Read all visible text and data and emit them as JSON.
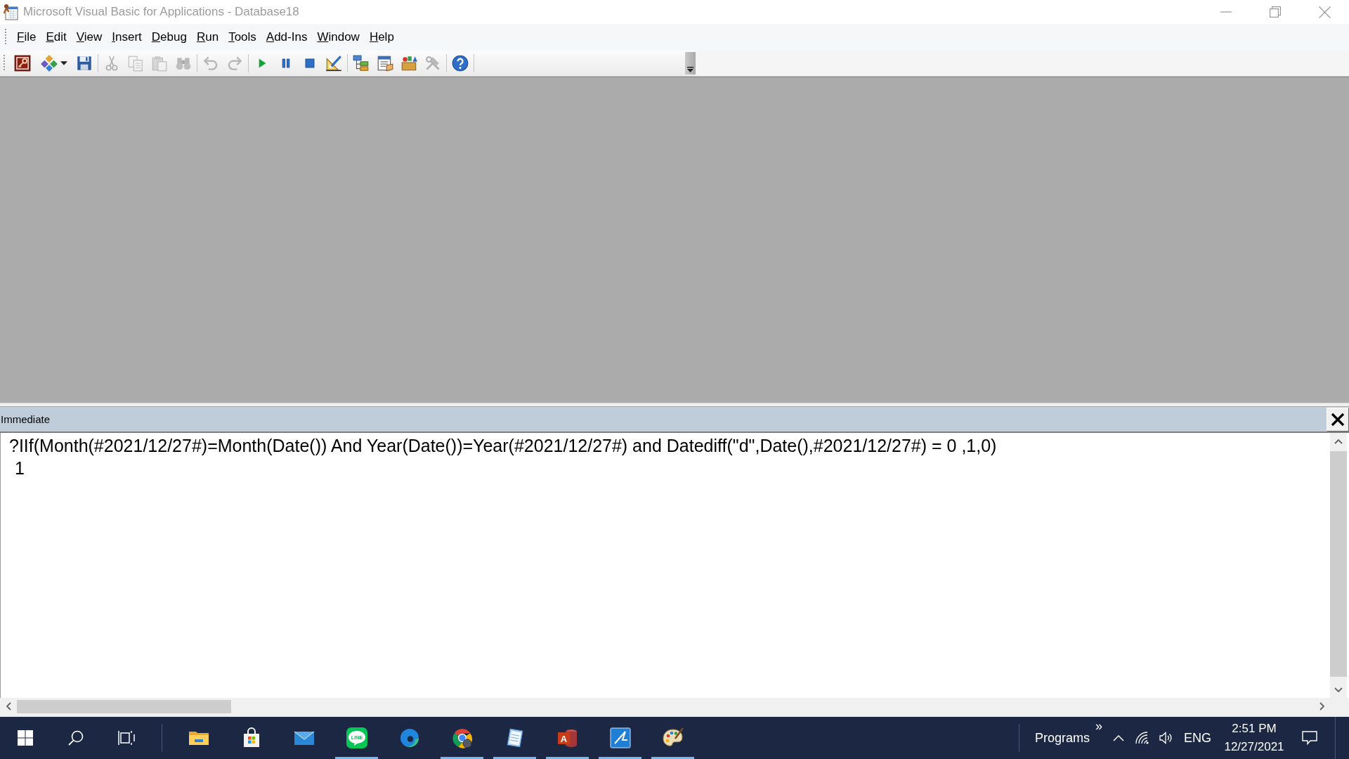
{
  "window": {
    "title": "Microsoft Visual Basic for Applications - Database18"
  },
  "menu": [
    "File",
    "Edit",
    "View",
    "Insert",
    "Debug",
    "Run",
    "Tools",
    "Add-Ins",
    "Window",
    "Help"
  ],
  "toolbar": [
    {
      "kind": "host",
      "disabled": false
    },
    {
      "kind": "module",
      "disabled": false
    },
    {
      "kind": "save",
      "disabled": false
    },
    {
      "kind": "separator"
    },
    {
      "kind": "cut",
      "disabled": true
    },
    {
      "kind": "copy",
      "disabled": true
    },
    {
      "kind": "paste",
      "disabled": true
    },
    {
      "kind": "find",
      "disabled": true
    },
    {
      "kind": "separator"
    },
    {
      "kind": "undo",
      "disabled": true
    },
    {
      "kind": "redo",
      "disabled": true
    },
    {
      "kind": "separator"
    },
    {
      "kind": "run",
      "disabled": false
    },
    {
      "kind": "break",
      "disabled": false
    },
    {
      "kind": "reset",
      "disabled": false
    },
    {
      "kind": "design",
      "disabled": false
    },
    {
      "kind": "separator"
    },
    {
      "kind": "project",
      "disabled": false
    },
    {
      "kind": "properties",
      "disabled": false
    },
    {
      "kind": "browser",
      "disabled": false
    },
    {
      "kind": "toolbox",
      "disabled": true
    },
    {
      "kind": "separator"
    },
    {
      "kind": "help",
      "disabled": false
    },
    {
      "kind": "separator"
    }
  ],
  "immediate": {
    "title": "Immediate",
    "lines": [
      {
        "kind": "input",
        "text": "?IIf(Month(#2021/12/27#)=Month(Date()) And Year(Date())=Year(#2021/12/27#) and Datediff(\"d\",Date(),#2021/12/27#) = 0 ,1,0)"
      },
      {
        "kind": "output",
        "text": "1"
      }
    ]
  },
  "taskbar": {
    "apps": [
      {
        "kind": "folder",
        "running": false
      },
      {
        "kind": "store",
        "running": false
      },
      {
        "kind": "mail",
        "running": false
      },
      {
        "kind": "chat",
        "running": true,
        "logo_text": "LINE"
      },
      {
        "kind": "swirl",
        "running": false
      },
      {
        "kind": "orb",
        "running": true
      },
      {
        "kind": "notes",
        "running": true
      },
      {
        "kind": "database",
        "running": true,
        "logo_text": "A"
      },
      {
        "kind": "tile",
        "running": true
      },
      {
        "kind": "paint",
        "running": true
      }
    ],
    "toolbar_label": "Programs",
    "toolbar_chevron": "»",
    "language": "ENG",
    "time": "2:51 PM",
    "date": "12/27/2021"
  }
}
